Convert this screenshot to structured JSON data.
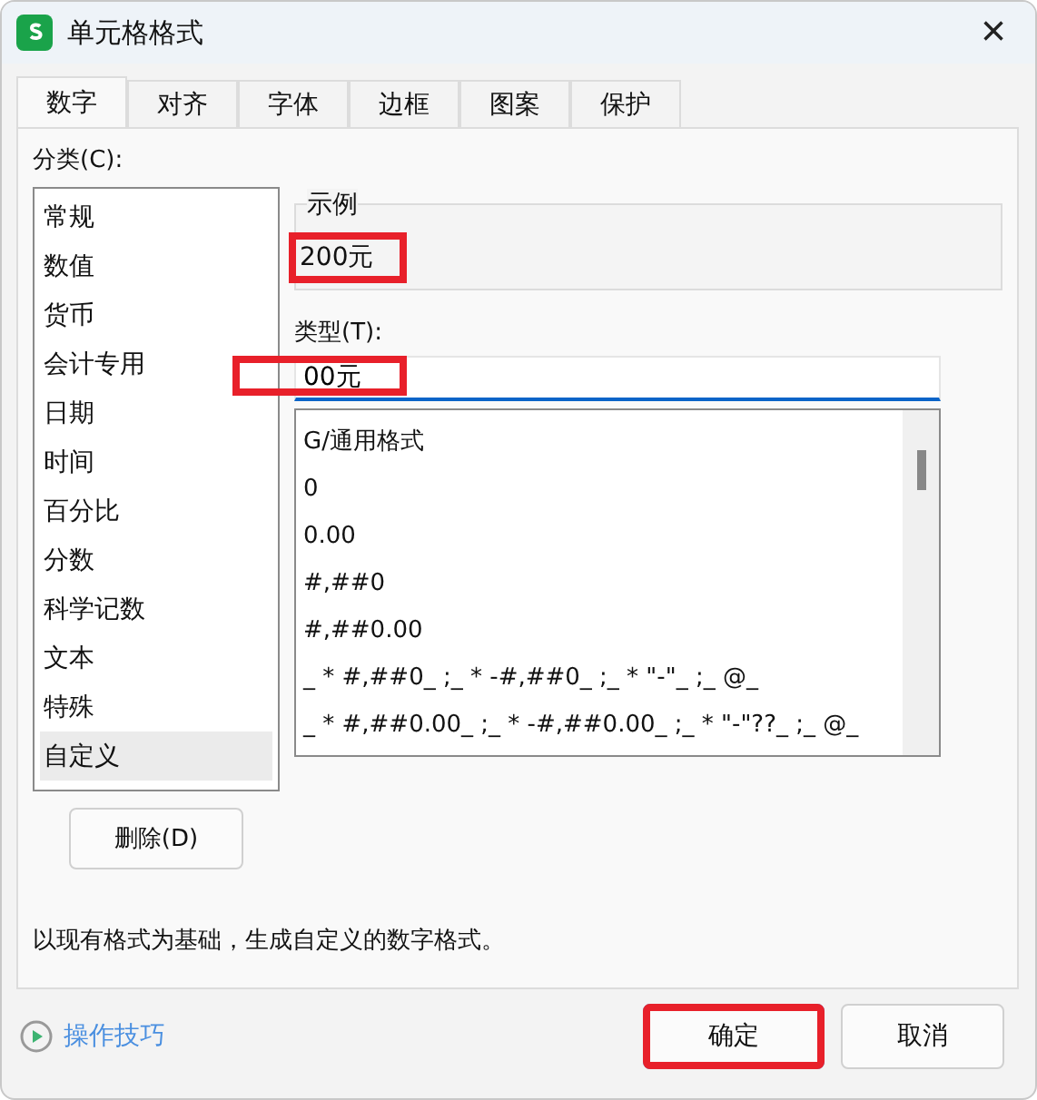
{
  "window": {
    "title": "单元格格式",
    "close": "×"
  },
  "tabs": [
    {
      "label": "数字",
      "selected": true
    },
    {
      "label": "对齐",
      "selected": false
    },
    {
      "label": "字体",
      "selected": false
    },
    {
      "label": "边框",
      "selected": false
    },
    {
      "label": "图案",
      "selected": false
    },
    {
      "label": "保护",
      "selected": false
    }
  ],
  "category": {
    "label": "分类(C):",
    "items": [
      {
        "label": "常规",
        "selected": false
      },
      {
        "label": "数值",
        "selected": false
      },
      {
        "label": "货币",
        "selected": false
      },
      {
        "label": "会计专用",
        "selected": false
      },
      {
        "label": "日期",
        "selected": false
      },
      {
        "label": "时间",
        "selected": false
      },
      {
        "label": "百分比",
        "selected": false
      },
      {
        "label": "分数",
        "selected": false
      },
      {
        "label": "科学记数",
        "selected": false
      },
      {
        "label": "文本",
        "selected": false
      },
      {
        "label": "特殊",
        "selected": false
      },
      {
        "label": "自定义",
        "selected": true
      }
    ]
  },
  "sample": {
    "label": "示例",
    "value": "200元",
    "highlighted": true
  },
  "type": {
    "label": "类型(T):",
    "value": "00元",
    "highlighted": true
  },
  "formats": [
    "G/通用格式",
    "0",
    "0.00",
    "#,##0",
    "#,##0.00",
    "_ * #,##0_ ;_ * -#,##0_ ;_ * \"-\"_ ;_ @_",
    "_ * #,##0.00_ ;_ * -#,##0.00_ ;_ * \"-\"??_ ;_ @_"
  ],
  "delete_button": "删除(D)",
  "description": "以现有格式为基础，生成自定义的数字格式。",
  "tips_link": "操作技巧",
  "buttons": [
    {
      "label": "确定",
      "kind": "primary",
      "highlighted": true
    },
    {
      "label": "取消",
      "kind": "secondary",
      "highlighted": false
    }
  ]
}
